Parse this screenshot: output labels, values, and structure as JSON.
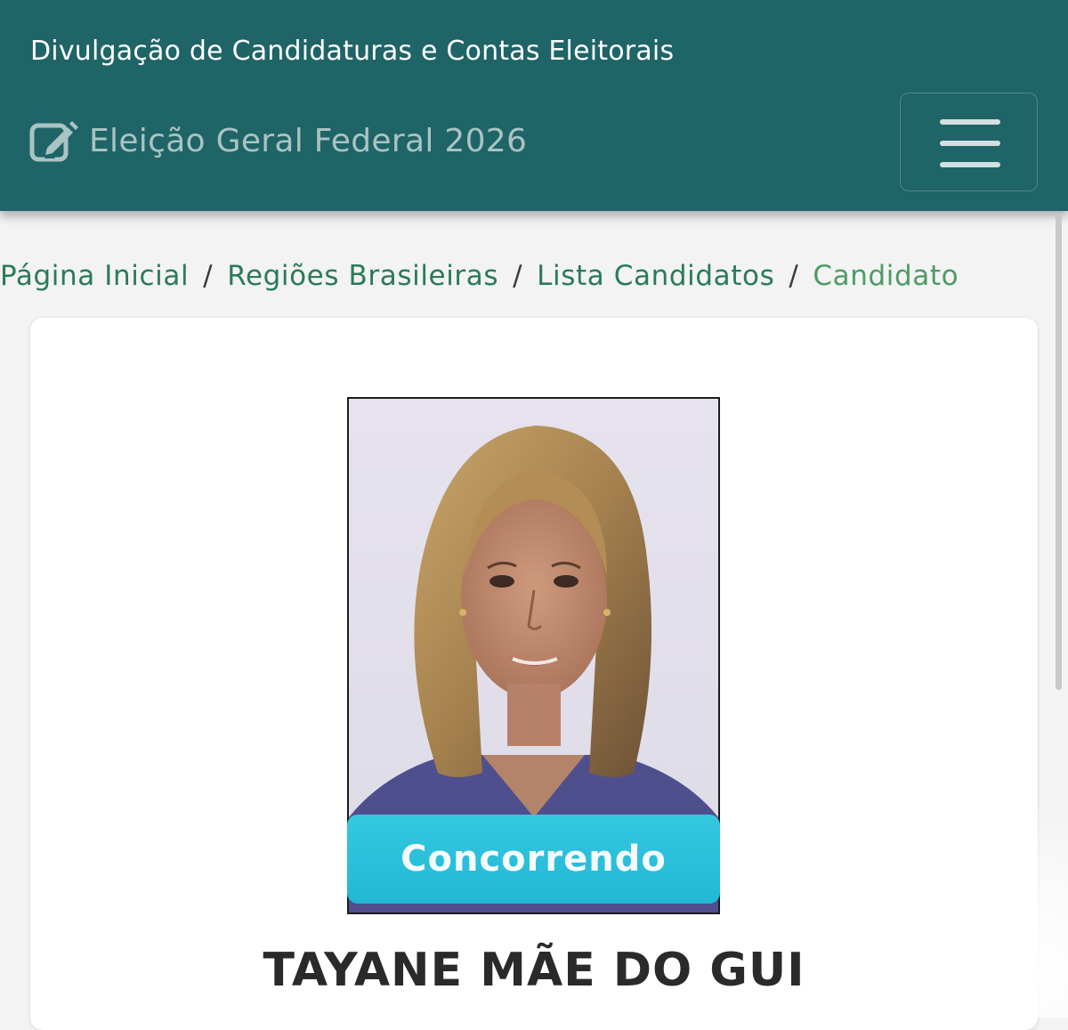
{
  "header": {
    "site_title": "Divulgação de Candidaturas e Contas Eleitorais",
    "election_name": "Eleição Geral Federal 2026",
    "menu_icon": "hamburger-menu-icon",
    "edit_icon": "edit-icon",
    "background_color": "#1f6467"
  },
  "breadcrumb": {
    "items": [
      "Página Inicial",
      "Regiões Brasileiras",
      "Lista Candidatos",
      "Candidato"
    ],
    "separator": "/"
  },
  "candidate": {
    "name": "TAYANE MÃE DO GUI",
    "status": "Concorrendo",
    "status_color": "#22b7d6"
  }
}
